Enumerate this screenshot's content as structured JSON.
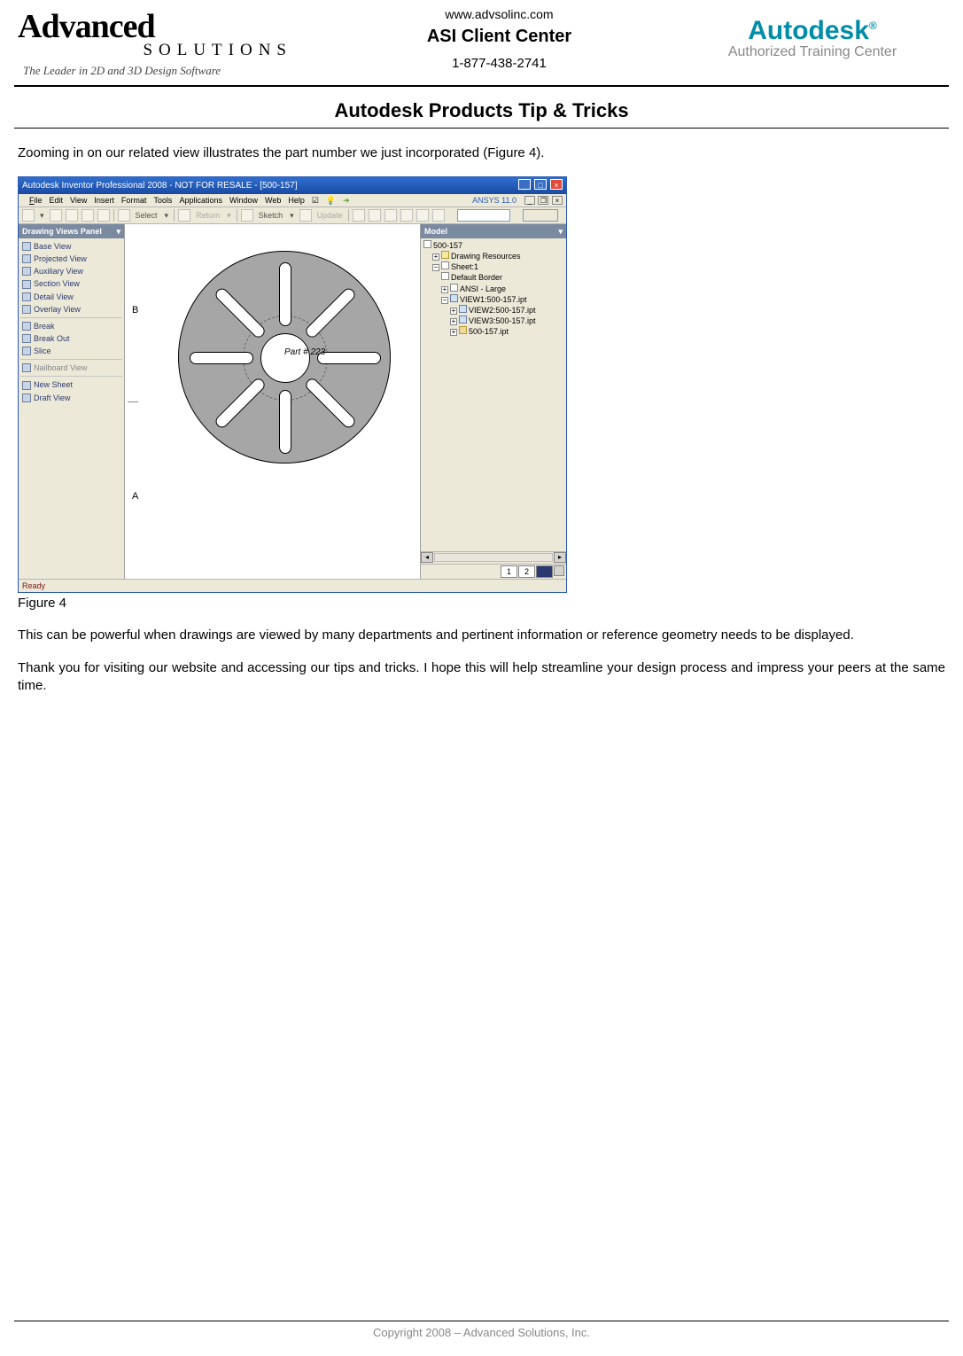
{
  "header": {
    "logo_main": "Advanced",
    "logo_sub": "SOLUTIONS",
    "logo_tag": "The Leader in 2D and 3D Design Software",
    "site": "www.advsolinc.com",
    "client_center": "ASI Client Center",
    "phone": "1-877-438-2741",
    "autodesk": "Autodesk",
    "autodesk_reg": "®",
    "atc": "Authorized Training Center"
  },
  "page_title": "Autodesk Products Tip & Tricks",
  "body": {
    "intro": "Zooming in on our related view illustrates the part number we just incorporated (Figure 4).",
    "p1": "This can be powerful when drawings are viewed by many departments and pertinent information or reference geometry needs to be displayed.",
    "p2": "Thank you for visiting our website and accessing our tips and tricks.  I hope this will help streamline your design process and impress your peers at the same time.",
    "fig_caption": "Figure 4"
  },
  "screenshot": {
    "title": "Autodesk Inventor Professional 2008 - NOT FOR RESALE - [500-157]",
    "menu": {
      "file": "File",
      "edit": "Edit",
      "view": "View",
      "insert": "Insert",
      "format": "Format",
      "tools": "Tools",
      "applications": "Applications",
      "window": "Window",
      "web": "Web",
      "help": "Help",
      "ext": "ANSYS 11.0"
    },
    "toolbar": {
      "select": "Select",
      "return": "Return",
      "sketch": "Sketch",
      "update": "Update"
    },
    "left_panel": {
      "header": "Drawing Views Panel",
      "items": [
        "Base View",
        "Projected View",
        "Auxiliary View",
        "Section View",
        "Detail View",
        "Overlay View"
      ],
      "items2": [
        "Break",
        "Break Out",
        "Slice"
      ],
      "items3": [
        "Nailboard View"
      ],
      "items4": [
        "New Sheet",
        "Draft View"
      ]
    },
    "canvas": {
      "row_a": "A",
      "row_b": "B",
      "part_label": "Part # 223"
    },
    "right_panel": {
      "header": "Model",
      "root": "500-157",
      "drawing_resources": "Drawing Resources",
      "sheet": "Sheet:1",
      "default_border": "Default Border",
      "ansi": "ANSI - Large",
      "view1": "VIEW1:500-157.ipt",
      "view2": "VIEW2:500-157.ipt",
      "view3": "VIEW3:500-157.ipt",
      "part": "500-157.ipt"
    },
    "sheet_tabs": {
      "t1": "1",
      "t2": "2"
    },
    "status": "Ready"
  },
  "footer": {
    "copyright": "Copyright 2008 – Advanced Solutions, Inc."
  }
}
